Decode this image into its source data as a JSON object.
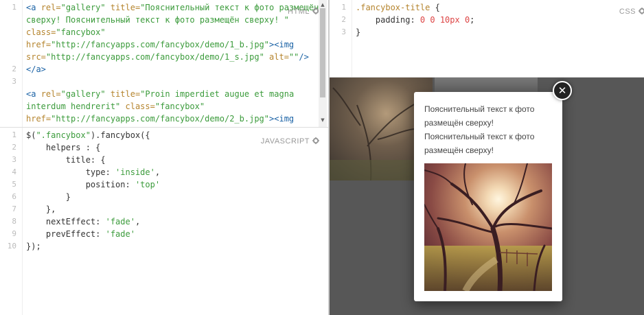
{
  "html_panel": {
    "label": "HTML",
    "line_numbers": [
      "1",
      "",
      "",
      "",
      "",
      "2",
      "3",
      "",
      "",
      ""
    ],
    "lines": [
      [
        [
          "tag",
          "<a "
        ],
        [
          "attr",
          "rel="
        ],
        [
          "str",
          "\"gallery\""
        ],
        [
          "attr",
          " title="
        ],
        [
          "str",
          "\"Пояснительный текст к фото размещён"
        ]
      ],
      [
        [
          "str",
          "сверху! Пояснительный текст к фото размещён сверху! \""
        ]
      ],
      [
        [
          "attr",
          "class="
        ],
        [
          "str",
          "\"fancybox\""
        ]
      ],
      [
        [
          "attr",
          "href="
        ],
        [
          "str",
          "\"http://fancyapps.com/fancybox/demo/1_b.jpg\""
        ],
        [
          "tag",
          "><img"
        ]
      ],
      [
        [
          "attr",
          "src="
        ],
        [
          "str",
          "\"http://fancyapps.com/fancybox/demo/1_s.jpg\""
        ],
        [
          "attr",
          " alt="
        ],
        [
          "str",
          "\"\""
        ],
        [
          "tag",
          "/>"
        ]
      ],
      [
        [
          "tag",
          "</a>"
        ]
      ],
      [
        [
          "plain",
          ""
        ]
      ],
      [
        [
          "tag",
          "<a "
        ],
        [
          "attr",
          "rel="
        ],
        [
          "str",
          "\"gallery\""
        ],
        [
          "attr",
          " title="
        ],
        [
          "str",
          "\"Proin imperdiet augue et magna"
        ]
      ],
      [
        [
          "str",
          "interdum hendrerit\""
        ],
        [
          "attr",
          " class="
        ],
        [
          "str",
          "\"fancybox\""
        ]
      ],
      [
        [
          "attr",
          "href="
        ],
        [
          "str",
          "\"http://fancyapps.com/fancybox/demo/2_b.jpg\""
        ],
        [
          "tag",
          "><img"
        ]
      ]
    ]
  },
  "js_panel": {
    "label": "JAVASCRIPT",
    "line_numbers": [
      "1",
      "2",
      "3",
      "4",
      "5",
      "6",
      "7",
      "8",
      "9",
      "10"
    ],
    "lines": [
      [
        [
          "plain",
          "$("
        ],
        [
          "str",
          "\".fancybox\""
        ],
        [
          "plain",
          ").fancybox({"
        ]
      ],
      [
        [
          "plain",
          "    helpers : {"
        ]
      ],
      [
        [
          "plain",
          "        title: {"
        ]
      ],
      [
        [
          "plain",
          "            type: "
        ],
        [
          "str",
          "'inside'"
        ],
        [
          "plain",
          ","
        ]
      ],
      [
        [
          "plain",
          "            position: "
        ],
        [
          "str",
          "'top'"
        ]
      ],
      [
        [
          "plain",
          "        }"
        ]
      ],
      [
        [
          "plain",
          "    },"
        ]
      ],
      [
        [
          "plain",
          "    nextEffect: "
        ],
        [
          "str",
          "'fade'"
        ],
        [
          "plain",
          ","
        ]
      ],
      [
        [
          "plain",
          "    prevEffect: "
        ],
        [
          "str",
          "'fade'"
        ]
      ],
      [
        [
          "plain",
          "});"
        ]
      ]
    ]
  },
  "css_panel": {
    "label": "CSS",
    "line_numbers": [
      "1",
      "2",
      "3"
    ],
    "lines": [
      [
        [
          "sel",
          ".fancybox-title"
        ],
        [
          "plain",
          " {"
        ]
      ],
      [
        [
          "plain",
          "    padding: "
        ],
        [
          "num",
          "0 0 10px 0"
        ],
        [
          "plain",
          ";"
        ]
      ],
      [
        [
          "plain",
          "}"
        ]
      ]
    ]
  },
  "result": {
    "popup_title": "Пояснительный текст к фото размещён сверху! Пояснительный текст к фото размещён сверху!",
    "close_glyph": "✕"
  },
  "colors": {
    "tag": "#1a62a5",
    "attr": "#b5842d",
    "string": "#3b9b3b",
    "number": "#d44444",
    "overlay": "#575757"
  }
}
